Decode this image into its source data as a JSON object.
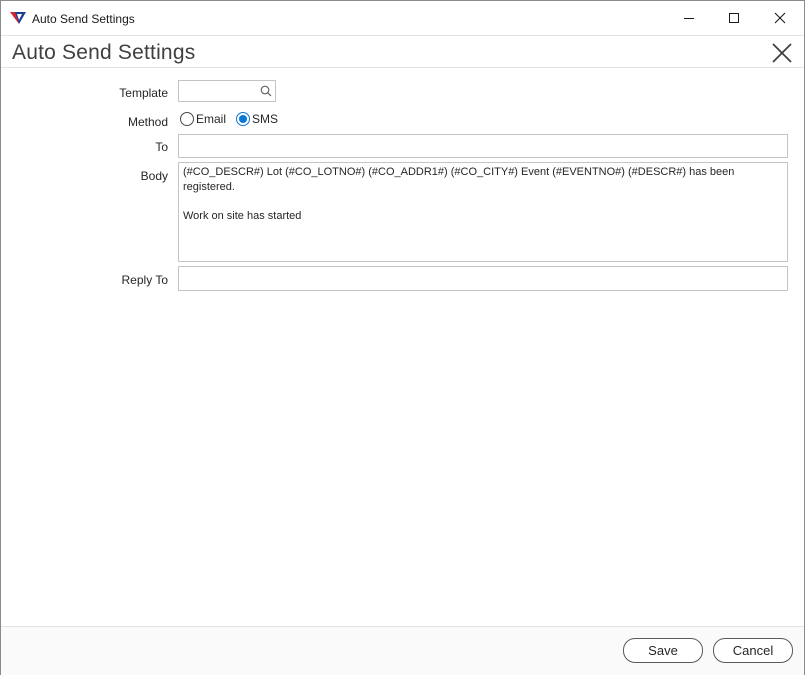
{
  "window": {
    "title": "Auto Send Settings",
    "app_icon": "app-logo-icon",
    "controls": {
      "minimize": "minimize-icon",
      "maximize": "maximize-icon",
      "close": "close-icon"
    }
  },
  "dialog": {
    "title": "Auto Send Settings",
    "close_icon": "close-icon"
  },
  "form": {
    "template": {
      "label": "Template",
      "value": "",
      "search_icon": "search-icon"
    },
    "method": {
      "label": "Method",
      "options": [
        {
          "label": "Email",
          "checked": false
        },
        {
          "label": "SMS",
          "checked": true
        }
      ]
    },
    "to": {
      "label": "To",
      "value": ""
    },
    "body": {
      "label": "Body",
      "value": "(#CO_DESCR#) Lot (#CO_LOTNO#) (#CO_ADDR1#) (#CO_CITY#) Event (#EVENTNO#) (#DESCR#) has been registered.\n\nWork on site has started"
    },
    "reply_to": {
      "label": "Reply To",
      "value": ""
    }
  },
  "footer": {
    "save_label": "Save",
    "cancel_label": "Cancel"
  },
  "colors": {
    "accent": "#0a78d4",
    "logo_red": "#d7262e",
    "logo_blue": "#1c3f94"
  }
}
